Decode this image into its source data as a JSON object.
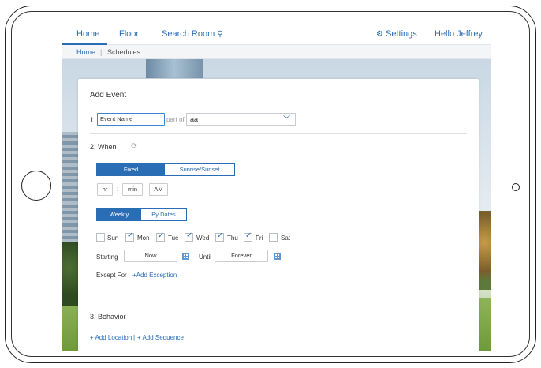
{
  "nav": {
    "home": "Home",
    "floor": "Floor",
    "search": "Search Room",
    "search_icon": "⚲",
    "settings": "Settings",
    "settings_icon": "⚙",
    "hello": "Hello Jeffrey"
  },
  "breadcrumb": {
    "home": "Home",
    "sep": "|",
    "current": "Schedules"
  },
  "form": {
    "title": "Add Event",
    "step1_num": "1.",
    "event_name": "Event Name",
    "part_of": "part of",
    "part_of_value": "aa",
    "step2": "2. When",
    "mode_tabs": [
      "Fixed",
      "Sunrise/Sunset"
    ],
    "hr": "hr",
    "colon": ":",
    "min": "min",
    "ampm": "AM",
    "freq_tabs": [
      "Weekly",
      "By Dates"
    ],
    "days": [
      {
        "label": "Sun",
        "checked": false
      },
      {
        "label": "Mon",
        "checked": true
      },
      {
        "label": "Tue",
        "checked": true
      },
      {
        "label": "Wed",
        "checked": true
      },
      {
        "label": "Thu",
        "checked": true
      },
      {
        "label": "Fri",
        "checked": true
      },
      {
        "label": "Sat",
        "checked": false
      }
    ],
    "starting": "Starting",
    "starting_value": "Now",
    "until": "Until",
    "until_value": "Forever",
    "except_for": "Except For",
    "add_exception": "+Add Exception",
    "step3": "3. Behavior",
    "add_location": "+ Add Location",
    "link_sep": "|",
    "add_sequence": "+ Add Sequence"
  },
  "colors": {
    "accent": "#2a6db5"
  }
}
